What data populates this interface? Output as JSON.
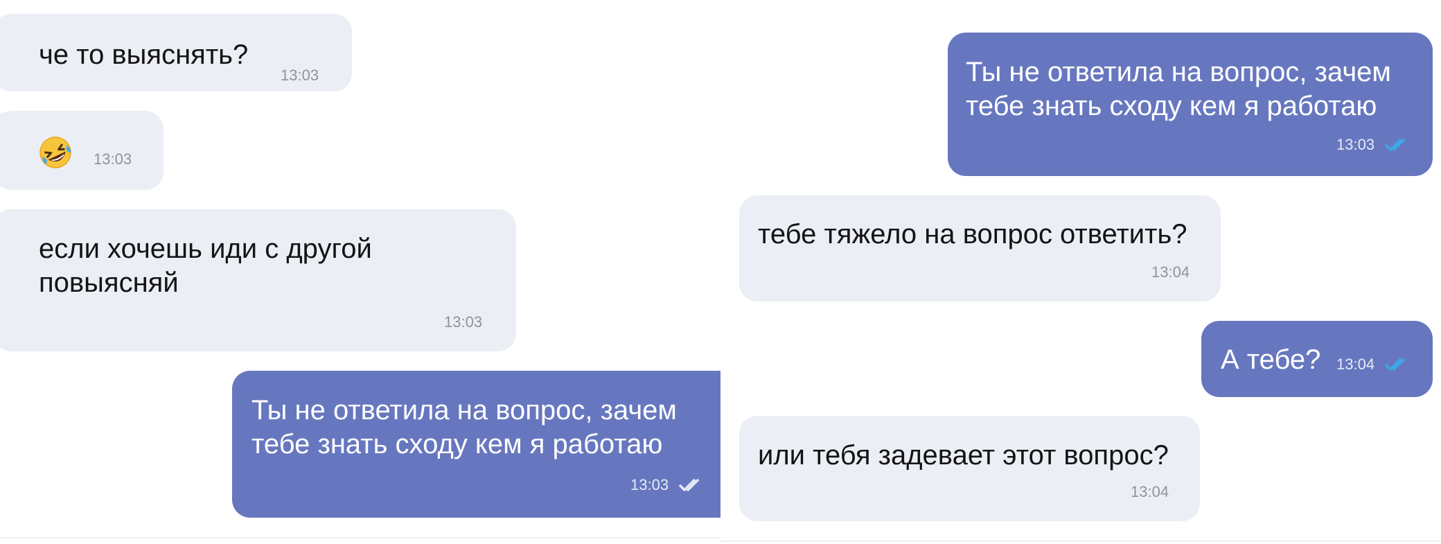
{
  "left_panel": {
    "messages": [
      {
        "direction": "in",
        "text": "че то выяснять?",
        "time": "13:03"
      },
      {
        "direction": "in",
        "emoji": "rolling-on-floor-laughing",
        "time": "13:03"
      },
      {
        "direction": "in",
        "lines": [
          "если хочешь иди с другой",
          "повыясняй"
        ],
        "time": "13:03"
      },
      {
        "direction": "out",
        "lines": [
          "Ты не ответила на вопрос, зачем",
          "тебе знать сходу кем я работаю"
        ],
        "time": "13:03",
        "status": "read"
      }
    ]
  },
  "right_panel": {
    "messages": [
      {
        "direction": "out",
        "lines": [
          "Ты не ответила на вопрос, зачем",
          "тебе знать сходу кем я работаю"
        ],
        "time": "13:03",
        "status": "read"
      },
      {
        "direction": "in",
        "text": "тебе тяжело на вопрос ответить?",
        "time": "13:04"
      },
      {
        "direction": "out",
        "text": "А тебе?",
        "time": "13:04",
        "status": "read"
      },
      {
        "direction": "in",
        "text": "или тебя задевает этот вопрос?",
        "time": "13:04"
      }
    ]
  },
  "colors": {
    "incoming_bubble": "#eceef5",
    "outgoing_bubble": "#6777bf",
    "incoming_text": "#141414",
    "outgoing_text": "#ffffff",
    "incoming_time": "#909396",
    "outgoing_time": "#e8ebf7",
    "read_check_white": "#e6e9f6",
    "read_check_blue": "#3fa7e6",
    "background": "#ffffff"
  }
}
